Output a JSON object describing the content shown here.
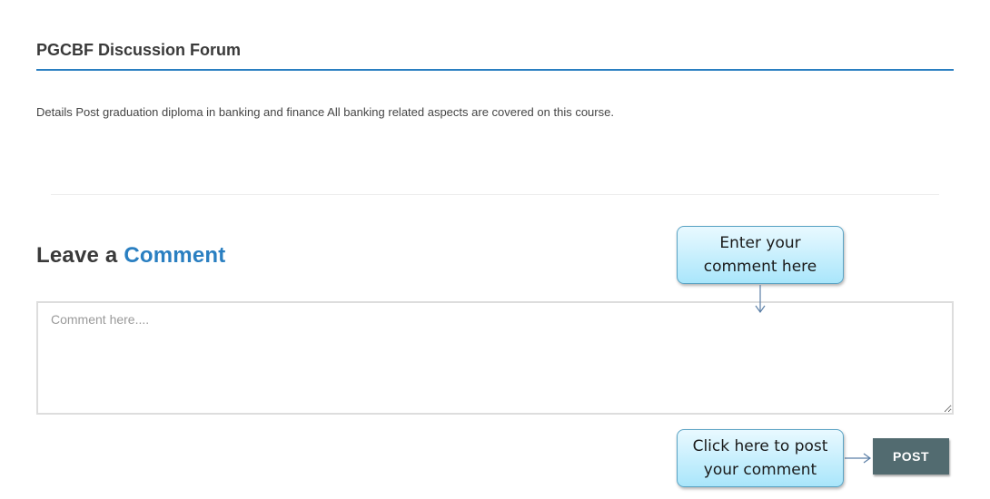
{
  "forum": {
    "title": "PGCBF Discussion Forum",
    "details": "Details Post graduation diploma in banking and finance All banking related aspects are covered on this course."
  },
  "comment_section": {
    "heading_prefix": "Leave a ",
    "heading_accent": "Comment",
    "placeholder": "Comment here....",
    "value": "",
    "post_label": "POST"
  },
  "annotations": {
    "comment_callout": "Enter your comment here",
    "post_callout": "Click here to post your comment"
  },
  "colors": {
    "accent": "#2a7fc1",
    "post_button": "#526b70",
    "callout_fill": "#a9e6fb"
  }
}
